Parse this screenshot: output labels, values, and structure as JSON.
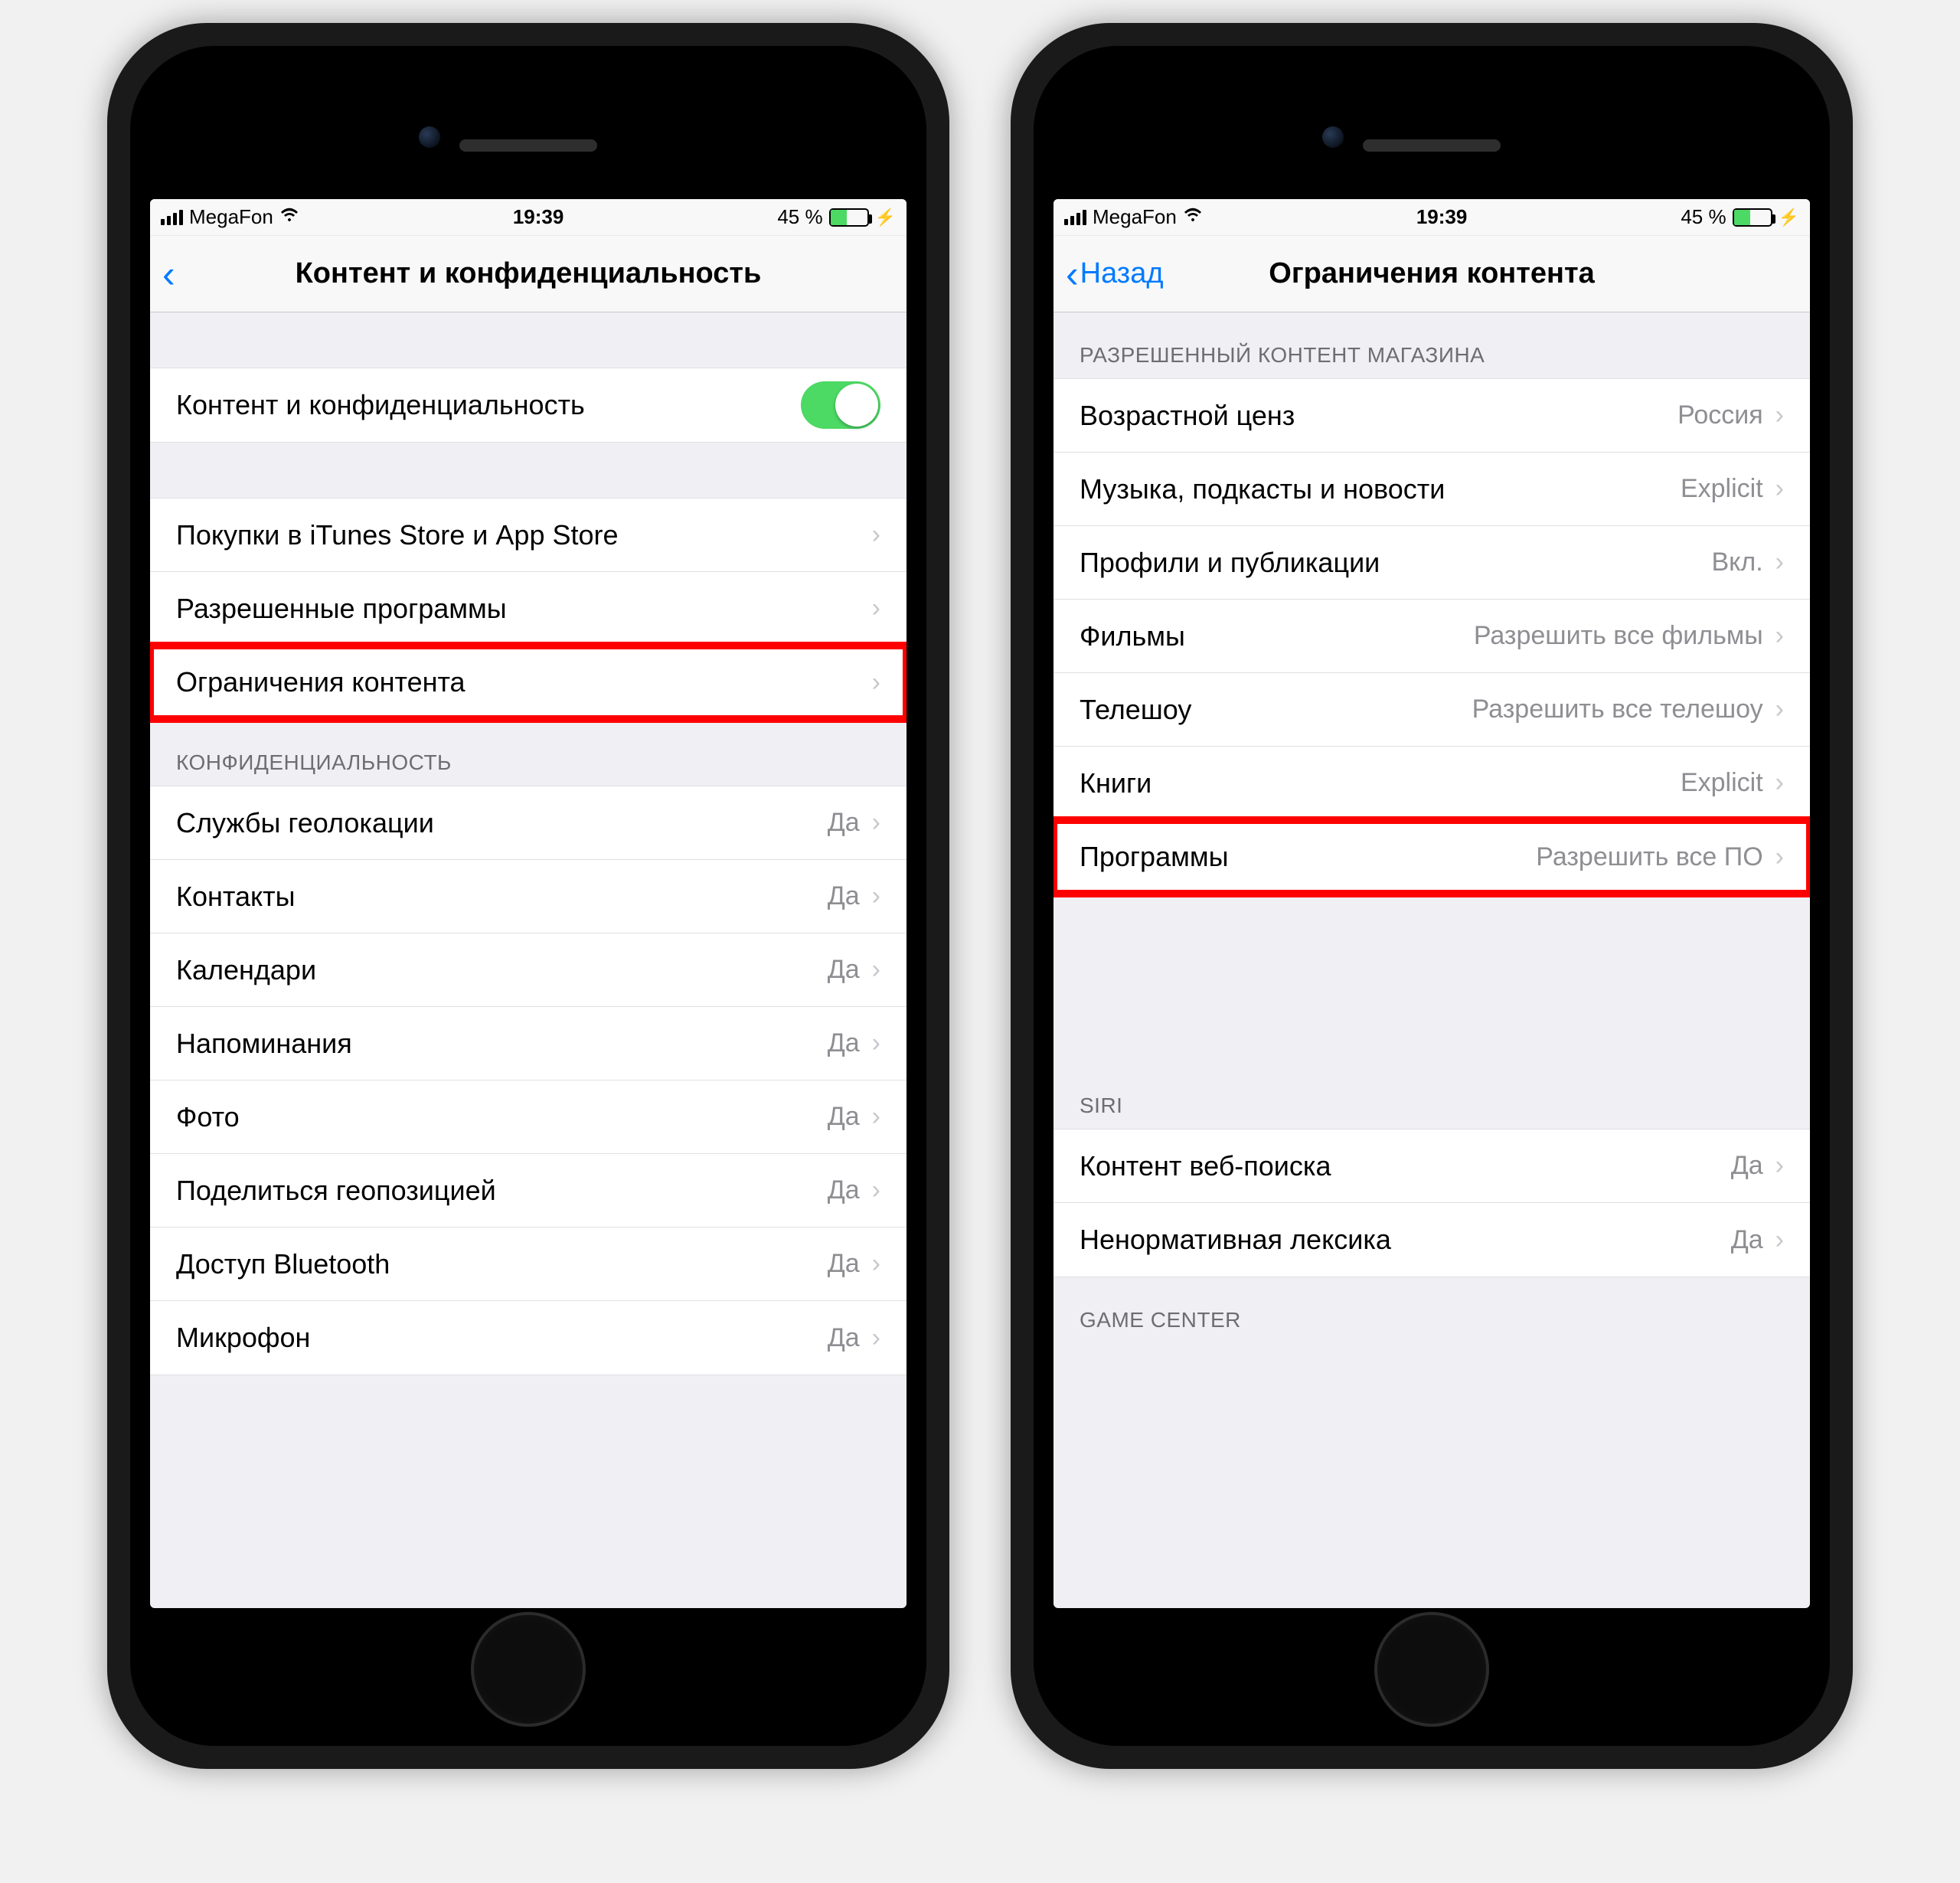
{
  "status": {
    "carrier": "MegaFon",
    "time": "19:39",
    "battery_pct": "45 %",
    "battery_fill_pct": 45
  },
  "phone_left": {
    "title": "Контент и конфиденциальность",
    "toggle_row": {
      "label": "Контент и конфиденциальность",
      "on": true
    },
    "group_store": [
      {
        "label": "Покупки в iTunes Store и App Store"
      },
      {
        "label": "Разрешенные программы"
      },
      {
        "label": "Ограничения контента",
        "highlight": true
      }
    ],
    "section_privacy_header": "КОНФИДЕНЦИАЛЬНОСТЬ",
    "privacy_rows": [
      {
        "label": "Службы геолокации",
        "value": "Да"
      },
      {
        "label": "Контакты",
        "value": "Да"
      },
      {
        "label": "Календари",
        "value": "Да"
      },
      {
        "label": "Напоминания",
        "value": "Да"
      },
      {
        "label": "Фото",
        "value": "Да"
      },
      {
        "label": "Поделиться геопозицией",
        "value": "Да"
      },
      {
        "label": "Доступ Bluetooth",
        "value": "Да"
      },
      {
        "label": "Микрофон",
        "value": "Да"
      }
    ]
  },
  "phone_right": {
    "back_label": "Назад",
    "title": "Ограничения контента",
    "section_store_header": "РАЗРЕШЕННЫЙ КОНТЕНТ МАГАЗИНА",
    "store_rows": [
      {
        "label": "Возрастной ценз",
        "value": "Россия"
      },
      {
        "label": "Музыка, подкасты и новости",
        "value": "Explicit"
      },
      {
        "label": "Профили и публикации",
        "value": "Вкл."
      },
      {
        "label": "Фильмы",
        "value": "Разрешить все фильмы"
      },
      {
        "label": "Телешоу",
        "value": "Разрешить все телешоу"
      },
      {
        "label": "Книги",
        "value": "Explicit"
      },
      {
        "label": "Программы",
        "value": "Разрешить все ПО",
        "highlight": true
      }
    ],
    "section_siri_header": "SIRI",
    "siri_rows": [
      {
        "label": "Контент веб-поиска",
        "value": "Да"
      },
      {
        "label": "Ненормативная лексика",
        "value": "Да"
      }
    ],
    "section_gamecenter_header": "GAME CENTER"
  }
}
